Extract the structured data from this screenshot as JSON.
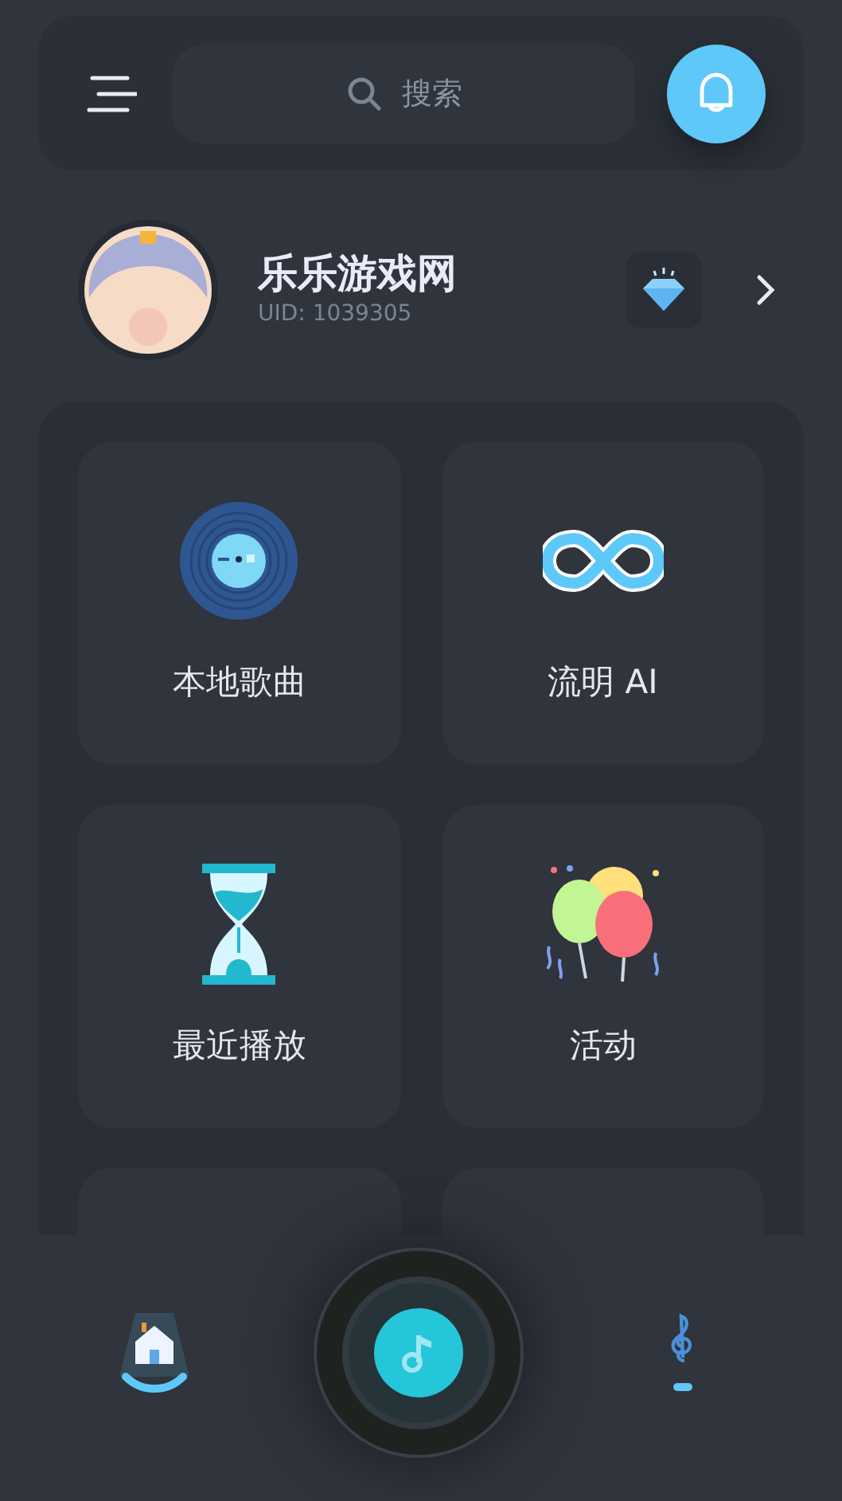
{
  "header": {
    "search": {
      "placeholder": "搜索"
    }
  },
  "profile": {
    "name": "乐乐游戏网",
    "uid": "UID: 1039305"
  },
  "tiles": [
    {
      "kind": "disc",
      "label": "本地歌曲"
    },
    {
      "kind": "infinity",
      "label": "流明 AI"
    },
    {
      "kind": "hourglass",
      "label": "最近播放"
    },
    {
      "kind": "balloons",
      "label": "活动"
    },
    {
      "kind": "blank"
    },
    {
      "kind": "blank"
    }
  ],
  "nav": [
    {
      "kind": "home",
      "selected": true
    },
    {
      "kind": "play"
    },
    {
      "kind": "clef",
      "selected": false
    }
  ]
}
